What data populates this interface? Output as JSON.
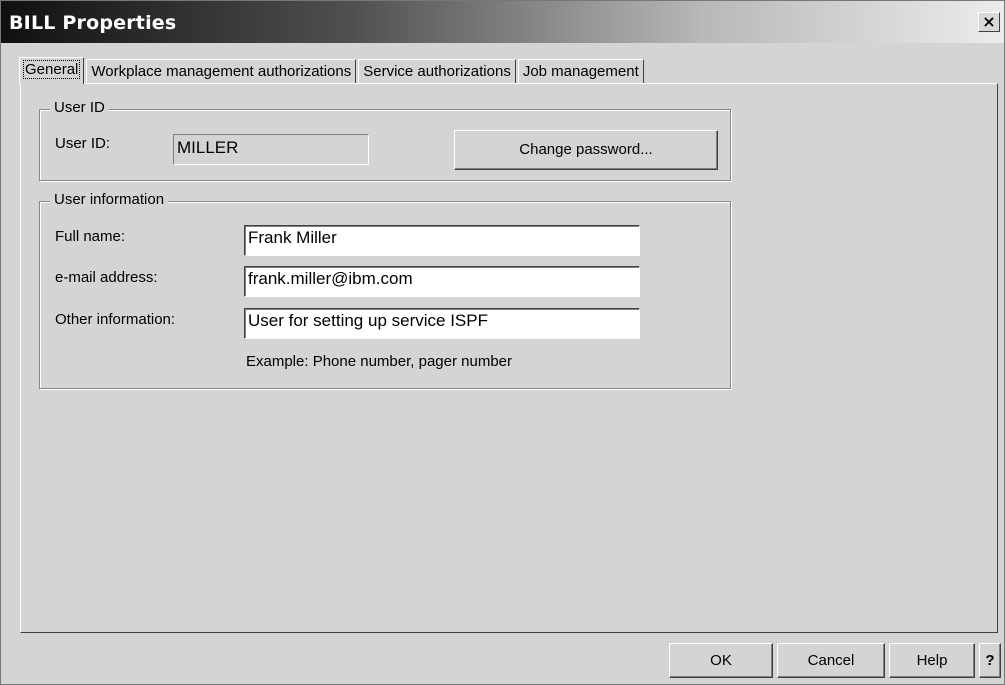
{
  "window": {
    "title": "BILL Properties",
    "close_label": "×"
  },
  "tabs": [
    {
      "label": "General"
    },
    {
      "label": "Workplace management authorizations"
    },
    {
      "label": "Service authorizations"
    },
    {
      "label": "Job management"
    }
  ],
  "user_id_group": {
    "legend": "User ID",
    "label": "User ID:",
    "value": "MILLER",
    "change_password_label": "Change password..."
  },
  "user_info_group": {
    "legend": "User information",
    "full_name_label": "Full name:",
    "full_name_value": "Frank Miller",
    "email_label": "e-mail address:",
    "email_value": "frank.miller@ibm.com",
    "other_label": "Other information:",
    "other_value": "User for setting up service ISPF",
    "hint": "Example: Phone number, pager number"
  },
  "footer": {
    "ok_label": "OK",
    "cancel_label": "Cancel",
    "help_label": "Help",
    "context_help_label": "?"
  }
}
